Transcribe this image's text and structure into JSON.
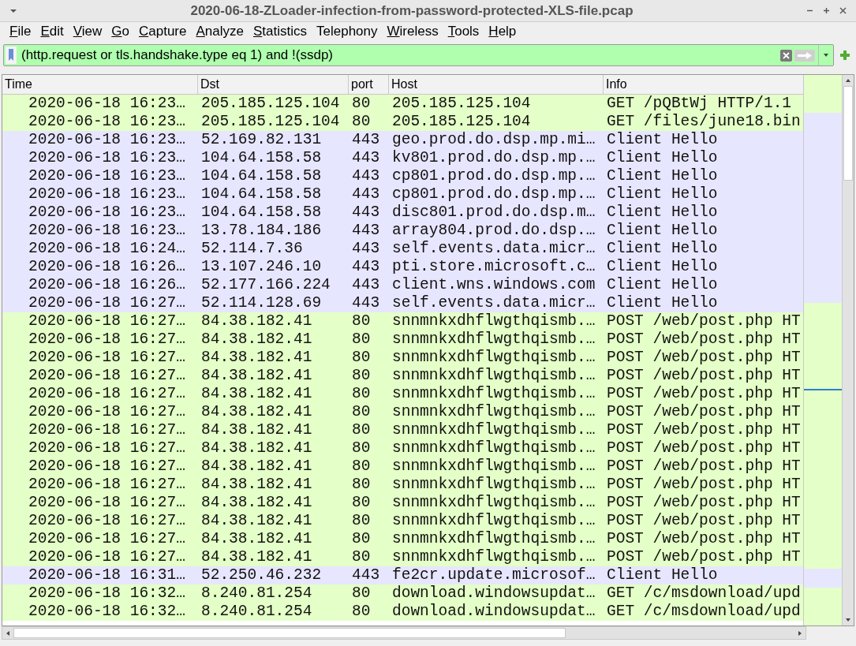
{
  "window": {
    "title": "2020-06-18-ZLoader-infection-from-password-protected-XLS-file.pcap"
  },
  "menu": [
    {
      "label": "File",
      "mnemonic": true
    },
    {
      "label": "Edit",
      "mnemonic": true
    },
    {
      "label": "View",
      "mnemonic": true
    },
    {
      "label": "Go",
      "mnemonic": true
    },
    {
      "label": "Capture",
      "mnemonic": true
    },
    {
      "label": "Analyze",
      "mnemonic": true
    },
    {
      "label": "Statistics",
      "mnemonic": true
    },
    {
      "label": "Telephony",
      "mnemonic": false
    },
    {
      "label": "Wireless",
      "mnemonic": true
    },
    {
      "label": "Tools",
      "mnemonic": true
    },
    {
      "label": "Help",
      "mnemonic": true
    }
  ],
  "filter": {
    "value": "(http.request or tls.handshake.type eq 1) and !(ssdp)"
  },
  "table": {
    "columns": [
      "Time",
      "Dst",
      "port",
      "Host",
      "Info"
    ],
    "rows": [
      {
        "kind": "http",
        "cells": [
          "2020-06-18 16:23…",
          "205.185.125.104",
          "80",
          "205.185.125.104",
          "GET /pQBtWj HTTP/1.1"
        ]
      },
      {
        "kind": "http",
        "cells": [
          "2020-06-18 16:23…",
          "205.185.125.104",
          "80",
          "205.185.125.104",
          "GET /files/june18.bin"
        ]
      },
      {
        "kind": "tls",
        "cells": [
          "2020-06-18 16:23…",
          "52.169.82.131",
          "443",
          "geo.prod.do.dsp.mp.mi…",
          "Client Hello"
        ]
      },
      {
        "kind": "tls",
        "cells": [
          "2020-06-18 16:23…",
          "104.64.158.58",
          "443",
          "kv801.prod.do.dsp.mp.…",
          "Client Hello"
        ]
      },
      {
        "kind": "tls",
        "cells": [
          "2020-06-18 16:23…",
          "104.64.158.58",
          "443",
          "cp801.prod.do.dsp.mp.…",
          "Client Hello"
        ]
      },
      {
        "kind": "tls",
        "cells": [
          "2020-06-18 16:23…",
          "104.64.158.58",
          "443",
          "cp801.prod.do.dsp.mp.…",
          "Client Hello"
        ]
      },
      {
        "kind": "tls",
        "cells": [
          "2020-06-18 16:23…",
          "104.64.158.58",
          "443",
          "disc801.prod.do.dsp.m…",
          "Client Hello"
        ]
      },
      {
        "kind": "tls",
        "cells": [
          "2020-06-18 16:23…",
          "13.78.184.186",
          "443",
          "array804.prod.do.dsp.…",
          "Client Hello"
        ]
      },
      {
        "kind": "tls",
        "cells": [
          "2020-06-18 16:24…",
          "52.114.7.36",
          "443",
          "self.events.data.micr…",
          "Client Hello"
        ]
      },
      {
        "kind": "tls",
        "cells": [
          "2020-06-18 16:26…",
          "13.107.246.10",
          "443",
          "pti.store.microsoft.c…",
          "Client Hello"
        ]
      },
      {
        "kind": "tls",
        "cells": [
          "2020-06-18 16:26…",
          "52.177.166.224",
          "443",
          "client.wns.windows.com",
          "Client Hello"
        ]
      },
      {
        "kind": "tls",
        "cells": [
          "2020-06-18 16:27…",
          "52.114.128.69",
          "443",
          "self.events.data.micr…",
          "Client Hello"
        ]
      },
      {
        "kind": "http",
        "cells": [
          "2020-06-18 16:27…",
          "84.38.182.41",
          "80",
          "snnmnkxdhflwgthqismb.…",
          "POST /web/post.php HT"
        ]
      },
      {
        "kind": "http",
        "cells": [
          "2020-06-18 16:27…",
          "84.38.182.41",
          "80",
          "snnmnkxdhflwgthqismb.…",
          "POST /web/post.php HT"
        ]
      },
      {
        "kind": "http",
        "cells": [
          "2020-06-18 16:27…",
          "84.38.182.41",
          "80",
          "snnmnkxdhflwgthqismb.…",
          "POST /web/post.php HT"
        ]
      },
      {
        "kind": "http",
        "cells": [
          "2020-06-18 16:27…",
          "84.38.182.41",
          "80",
          "snnmnkxdhflwgthqismb.…",
          "POST /web/post.php HT"
        ]
      },
      {
        "kind": "http",
        "cells": [
          "2020-06-18 16:27…",
          "84.38.182.41",
          "80",
          "snnmnkxdhflwgthqismb.…",
          "POST /web/post.php HT"
        ]
      },
      {
        "kind": "http",
        "cells": [
          "2020-06-18 16:27…",
          "84.38.182.41",
          "80",
          "snnmnkxdhflwgthqismb.…",
          "POST /web/post.php HT"
        ]
      },
      {
        "kind": "http",
        "cells": [
          "2020-06-18 16:27…",
          "84.38.182.41",
          "80",
          "snnmnkxdhflwgthqismb.…",
          "POST /web/post.php HT"
        ]
      },
      {
        "kind": "http",
        "cells": [
          "2020-06-18 16:27…",
          "84.38.182.41",
          "80",
          "snnmnkxdhflwgthqismb.…",
          "POST /web/post.php HT"
        ]
      },
      {
        "kind": "http",
        "cells": [
          "2020-06-18 16:27…",
          "84.38.182.41",
          "80",
          "snnmnkxdhflwgthqismb.…",
          "POST /web/post.php HT"
        ]
      },
      {
        "kind": "http",
        "cells": [
          "2020-06-18 16:27…",
          "84.38.182.41",
          "80",
          "snnmnkxdhflwgthqismb.…",
          "POST /web/post.php HT"
        ]
      },
      {
        "kind": "http",
        "cells": [
          "2020-06-18 16:27…",
          "84.38.182.41",
          "80",
          "snnmnkxdhflwgthqismb.…",
          "POST /web/post.php HT"
        ]
      },
      {
        "kind": "http",
        "cells": [
          "2020-06-18 16:27…",
          "84.38.182.41",
          "80",
          "snnmnkxdhflwgthqismb.…",
          "POST /web/post.php HT"
        ]
      },
      {
        "kind": "http",
        "cells": [
          "2020-06-18 16:27…",
          "84.38.182.41",
          "80",
          "snnmnkxdhflwgthqismb.…",
          "POST /web/post.php HT"
        ]
      },
      {
        "kind": "http",
        "cells": [
          "2020-06-18 16:27…",
          "84.38.182.41",
          "80",
          "snnmnkxdhflwgthqismb.…",
          "POST /web/post.php HT"
        ]
      },
      {
        "kind": "tls",
        "cells": [
          "2020-06-18 16:31…",
          "52.250.46.232",
          "443",
          "fe2cr.update.microsof…",
          "Client Hello"
        ]
      },
      {
        "kind": "http",
        "cells": [
          "2020-06-18 16:32…",
          "8.240.81.254",
          "80",
          "download.windowsupdat…",
          "GET /c/msdownload/upd"
        ]
      },
      {
        "kind": "http",
        "cells": [
          "2020-06-18 16:32…",
          "8.240.81.254",
          "80",
          "download.windowsupdat…",
          "GET /c/msdownload/upd"
        ]
      }
    ]
  }
}
